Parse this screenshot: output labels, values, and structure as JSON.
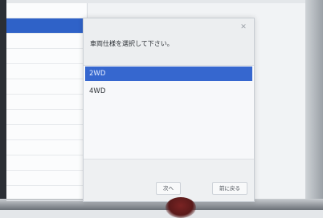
{
  "dialog": {
    "prompt": "車両仕様を選択して下さい。",
    "options": [
      {
        "label": "2WD",
        "selected": true
      },
      {
        "label": "4WD",
        "selected": false
      }
    ],
    "buttons": {
      "next_label": "次へ",
      "back_label": "前に戻る"
    }
  },
  "colors": {
    "selection": "#3667cf",
    "dialog_bg": "#f7f8fa",
    "header_bg": "#eceef0",
    "bezel": "#2b2f35"
  }
}
